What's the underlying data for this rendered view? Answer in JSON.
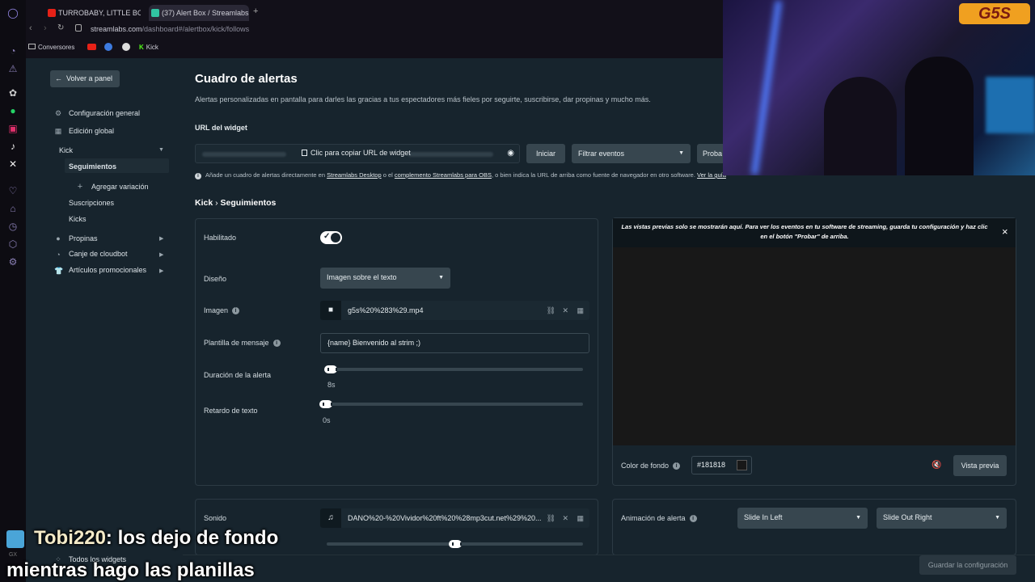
{
  "browser": {
    "tabs": [
      {
        "label": "TURROBABY, LITTLE BOO",
        "active": false
      },
      {
        "label": "(37) Alert Box / Streamlabs",
        "active": true
      }
    ],
    "new_tab": "+",
    "url_domain": "streamlabs.com",
    "url_path": "/dashboard#/alertbox/kick/follows",
    "bookmarks": [
      {
        "label": "Conversores"
      },
      {
        "label": "Kick"
      }
    ]
  },
  "nav": {
    "back_label": "Volver a panel",
    "items": [
      {
        "label": "Configuración general"
      },
      {
        "label": "Edición global"
      },
      {
        "label": "Kick"
      },
      {
        "label": "Seguimientos"
      },
      {
        "label": "Agregar variación"
      },
      {
        "label": "Suscripciones"
      },
      {
        "label": "Kicks"
      },
      {
        "label": "Propinas"
      },
      {
        "label": "Canje de cloudbot"
      },
      {
        "label": "Artículos promocionales"
      }
    ],
    "bottom_label": "Todos los widgets"
  },
  "header": {
    "title": "Cuadro de alertas",
    "subtitle": "Alertas personalizadas en pantalla para darles las gracias a tus espectadores más fieles por seguirte, suscribirse, dar propinas y mucho más."
  },
  "widget_url": {
    "label": "URL del widget",
    "copy_label": "Clic para copiar URL de widget",
    "start_button": "Iniciar",
    "filter_select": "Filtrar eventos",
    "test_button": "Proba",
    "info_prefix": "Añade un cuadro de alertas directamente en",
    "info_link1": "Streamlabs Desktop",
    "info_mid": "o el",
    "info_link2": "complemento Streamlabs para OBS",
    "info_suffix": ", o bien indica la URL de arriba como fuente de navegador en otro software.",
    "info_link3": "Ver la guía"
  },
  "breadcrumb": {
    "parent": "Kick",
    "sep": "›",
    "current": "Seguimientos"
  },
  "settings": {
    "enabled_label": "Habilitado",
    "design_label": "Diseño",
    "design_value": "Imagen sobre el texto",
    "image_label": "Imagen",
    "image_file": "g5s%20%283%29.mp4",
    "template_label": "Plantilla de mensaje",
    "template_value": "{name} Bienvenido al strim ;)",
    "duration_label": "Duración de la alerta",
    "duration_value": "8s",
    "duration_fraction": 0.0,
    "delay_label": "Retardo de texto",
    "delay_value": "0s",
    "delay_fraction": 0.0,
    "sound_label": "Sonido",
    "sound_file": "DANO%20-%20Vividor%20ft%20%28mp3cut.net%29%20...",
    "volume_fraction": 0.5
  },
  "preview": {
    "note": "Las vistas previas solo se mostrarán aquí. Para ver los eventos en tu software de streaming, guarda tu configuración y haz clic en el botón \"Probar\" de arriba.",
    "close": "×",
    "bg_color_label": "Color de fondo",
    "bg_color_value": "#181818",
    "preview_button": "Vista previa"
  },
  "animation": {
    "label": "Animación de alerta",
    "in_value": "Slide In Left",
    "out_value": "Slide Out Right"
  },
  "footer": {
    "save_button": "Guardar la configuración"
  },
  "chat_overlay": {
    "username": "Tobi220",
    "message_line1": ": los dejo de fondo",
    "message_line2": "mientras hago las planillas"
  },
  "webcam_logo": "G5S",
  "colors": {
    "background": "#17242d",
    "accent_button": "#37464f",
    "preview_bg": "#181818"
  }
}
